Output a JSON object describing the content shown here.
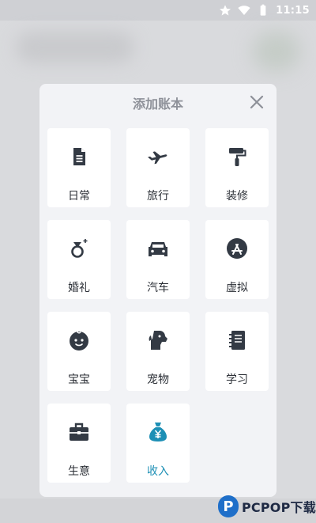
{
  "status_bar": {
    "time": "11:15",
    "icons": [
      "star-icon",
      "wifi-icon",
      "battery-icon"
    ]
  },
  "dialog": {
    "title": "添加账本",
    "close_icon": "close-icon",
    "items": [
      {
        "label": "日常",
        "icon": "document-icon"
      },
      {
        "label": "旅行",
        "icon": "airplane-icon"
      },
      {
        "label": "装修",
        "icon": "paint-roller-icon"
      },
      {
        "label": "婚礼",
        "icon": "wedding-ring-icon"
      },
      {
        "label": "汽车",
        "icon": "car-icon"
      },
      {
        "label": "虚拟",
        "icon": "app-store-icon"
      },
      {
        "label": "宝宝",
        "icon": "baby-face-icon"
      },
      {
        "label": "宠物",
        "icon": "dog-icon"
      },
      {
        "label": "学习",
        "icon": "notebook-icon"
      },
      {
        "label": "生意",
        "icon": "briefcase-icon"
      },
      {
        "label": "收入",
        "icon": "money-bag-icon",
        "highlight": true
      }
    ]
  },
  "colors": {
    "icon_dark": "#333a44",
    "accent": "#1d8fb5"
  },
  "watermark": {
    "text": "PCPOP下载"
  }
}
